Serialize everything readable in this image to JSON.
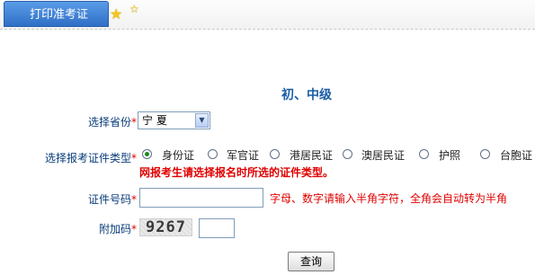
{
  "header": {
    "tab_label": "打印准考证",
    "star_icons": [
      "star-icon",
      "star-icon"
    ]
  },
  "form": {
    "heading": "初、中级",
    "province": {
      "label": "选择省份",
      "required_mark": "*",
      "selected": "宁 夏"
    },
    "id_type": {
      "label": "选择报考证件类型",
      "required_mark": "*",
      "options": [
        "身份证",
        "军官证",
        "港居民证",
        "澳居民证",
        "护照",
        "台胞证"
      ],
      "selected": "身份证",
      "warning": "网报考生请选择报名时所选的证件类型。"
    },
    "id_number": {
      "label": "证件号码",
      "required_mark": "*",
      "value": "",
      "hint": "字母、数字请输入半角字符，全角会自动转为半角"
    },
    "captcha": {
      "label": "附加码",
      "required_mark": "*",
      "image_text": "9267",
      "value": ""
    },
    "submit_label": "查询"
  },
  "colors": {
    "tab_blue": "#2f6fc6",
    "label_blue": "#0a3d7a",
    "warning_red": "#e00000",
    "heading_blue": "#1a5da6"
  }
}
